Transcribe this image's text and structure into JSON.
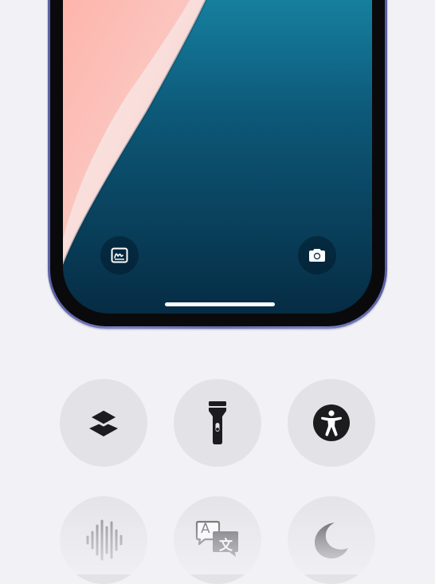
{
  "lockscreen": {
    "left_quick_action": "scribble-icon",
    "right_quick_action": "camera-icon"
  },
  "controls": [
    {
      "name": "stack-icon"
    },
    {
      "name": "flashlight-icon"
    },
    {
      "name": "accessibility-icon"
    },
    {
      "name": "waveform-icon"
    },
    {
      "name": "translate-icon",
      "glyphs": [
        "A",
        "文"
      ]
    },
    {
      "name": "moon-icon"
    }
  ],
  "colors": {
    "background": "#f2f2f6",
    "phone_frame": "#6a70b4",
    "wallpaper_blue": "#0d5878",
    "wallpaper_pink": "#f6a7a0",
    "control_bg": "#e2e2e7",
    "icon": "#1c1c1e"
  }
}
